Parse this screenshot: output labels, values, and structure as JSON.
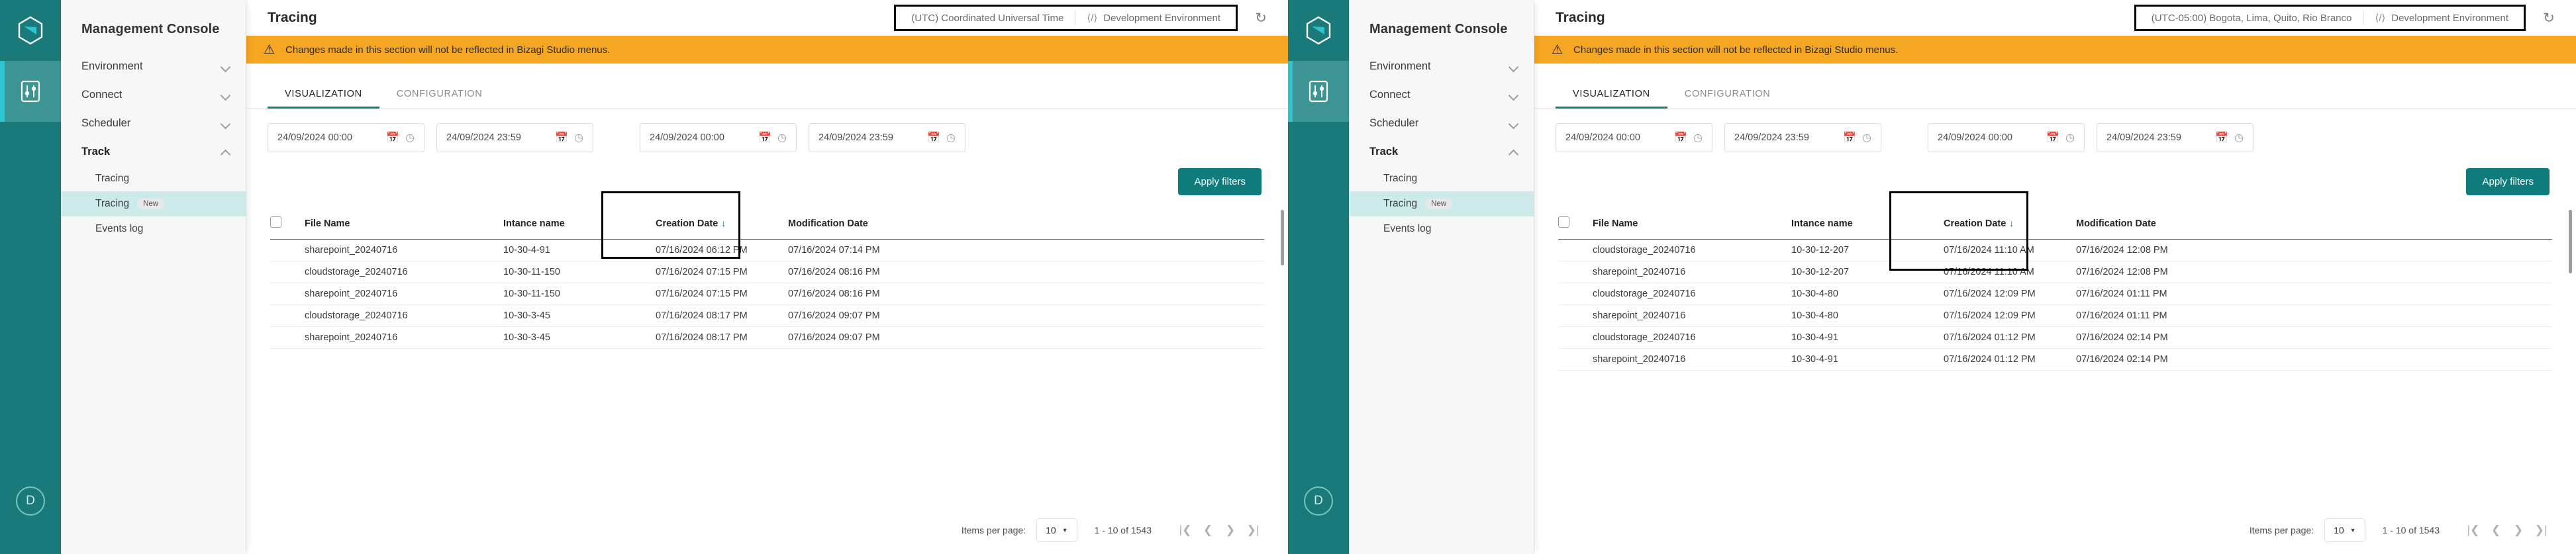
{
  "rail": {
    "logo_icon": "bizagi-hex-logo-icon",
    "tool_icon": "sliders-icon",
    "avatar_initial": "D"
  },
  "sidebar": {
    "title": "Management Console",
    "groups": [
      {
        "label": "Environment",
        "expanded": false
      },
      {
        "label": "Connect",
        "expanded": false
      },
      {
        "label": "Scheduler",
        "expanded": false
      },
      {
        "label": "Track",
        "expanded": true
      }
    ],
    "track_items": [
      {
        "label": "Tracing",
        "badge": "",
        "selected": false
      },
      {
        "label": "Tracing",
        "badge": "New",
        "selected": true
      },
      {
        "label": "Events log",
        "badge": "",
        "selected": false
      }
    ]
  },
  "panels": [
    {
      "title": "Tracing",
      "timezone": "(UTC) Coordinated Universal Time",
      "environment": "Development Environment",
      "refresh_icon": "refresh-icon",
      "warning": {
        "icon": "warning-triangle-icon",
        "text": "Changes made in this section will not be reflected in Bizagi Studio menus."
      },
      "tabs": [
        {
          "label": "VISUALIZATION",
          "active": true
        },
        {
          "label": "CONFIGURATION",
          "active": false
        }
      ],
      "filters": [
        {
          "value": "24/09/2024 00:00"
        },
        {
          "value": "24/09/2024 23:59"
        },
        {
          "value": "24/09/2024 00:00"
        },
        {
          "value": "24/09/2024 23:59"
        }
      ],
      "apply_label": "Apply filters",
      "table": {
        "columns": [
          "File Name",
          "Intance name",
          "Creation Date",
          "Modification Date"
        ],
        "sorted_column": "Creation Date",
        "sort_direction": "desc",
        "rows": [
          {
            "file": "sharepoint_20240716",
            "instance": "10-30-4-91",
            "created": "07/16/2024 06:12 PM",
            "modified": "07/16/2024 07:14 PM"
          },
          {
            "file": "cloudstorage_20240716",
            "instance": "10-30-11-150",
            "created": "07/16/2024 07:15 PM",
            "modified": "07/16/2024 08:16 PM"
          },
          {
            "file": "sharepoint_20240716",
            "instance": "10-30-11-150",
            "created": "07/16/2024 07:15 PM",
            "modified": "07/16/2024 08:16 PM"
          },
          {
            "file": "cloudstorage_20240716",
            "instance": "10-30-3-45",
            "created": "07/16/2024 08:17 PM",
            "modified": "07/16/2024 09:07 PM"
          },
          {
            "file": "sharepoint_20240716",
            "instance": "10-30-3-45",
            "created": "07/16/2024 08:17 PM",
            "modified": "07/16/2024 09:07 PM"
          }
        ]
      },
      "paginator": {
        "label": "Items per page:",
        "page_size": "10",
        "range": "1 - 10 of 1543"
      }
    },
    {
      "title": "Tracing",
      "timezone": "(UTC-05:00) Bogota, Lima, Quito, Rio Branco",
      "environment": "Development Environment",
      "refresh_icon": "refresh-icon",
      "warning": {
        "icon": "warning-triangle-icon",
        "text": "Changes made in this section will not be reflected in Bizagi Studio menus."
      },
      "tabs": [
        {
          "label": "VISUALIZATION",
          "active": true
        },
        {
          "label": "CONFIGURATION",
          "active": false
        }
      ],
      "filters": [
        {
          "value": "24/09/2024 00:00"
        },
        {
          "value": "24/09/2024 23:59"
        },
        {
          "value": "24/09/2024 00:00"
        },
        {
          "value": "24/09/2024 23:59"
        }
      ],
      "apply_label": "Apply filters",
      "table": {
        "columns": [
          "File Name",
          "Intance name",
          "Creation Date",
          "Modification Date"
        ],
        "sorted_column": "Creation Date",
        "sort_direction": "desc",
        "rows": [
          {
            "file": "cloudstorage_20240716",
            "instance": "10-30-12-207",
            "created": "07/16/2024 11:10 AM",
            "modified": "07/16/2024 12:08 PM"
          },
          {
            "file": "sharepoint_20240716",
            "instance": "10-30-12-207",
            "created": "07/16/2024 11:10 AM",
            "modified": "07/16/2024 12:08 PM"
          },
          {
            "file": "cloudstorage_20240716",
            "instance": "10-30-4-80",
            "created": "07/16/2024 12:09 PM",
            "modified": "07/16/2024 01:11 PM"
          },
          {
            "file": "sharepoint_20240716",
            "instance": "10-30-4-80",
            "created": "07/16/2024 12:09 PM",
            "modified": "07/16/2024 01:11 PM"
          },
          {
            "file": "cloudstorage_20240716",
            "instance": "10-30-4-91",
            "created": "07/16/2024 01:12 PM",
            "modified": "07/16/2024 02:14 PM"
          },
          {
            "file": "sharepoint_20240716",
            "instance": "10-30-4-91",
            "created": "07/16/2024 01:12 PM",
            "modified": "07/16/2024 02:14 PM"
          }
        ]
      },
      "paginator": {
        "label": "Items per page:",
        "page_size": "10",
        "range": "1 - 10 of 1543"
      }
    }
  ],
  "colors": {
    "teal_dark": "#1a7a7a",
    "teal_accent": "#2ec4cf",
    "teal_primary": "#0f7b7b",
    "warning_orange": "#f5a623",
    "selected_nav": "#cdeaea"
  }
}
